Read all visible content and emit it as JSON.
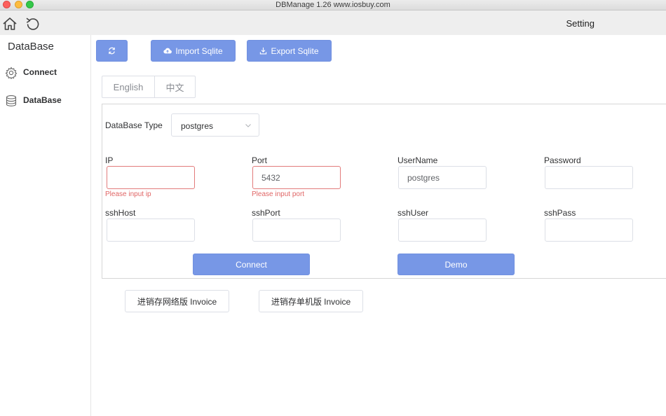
{
  "window": {
    "title": "DBManage 1.26 www.iosbuy.com"
  },
  "header": {
    "title": "Setting"
  },
  "sidebar": {
    "title": "DataBase",
    "items": [
      {
        "label": "Connect",
        "icon": "gear-icon"
      },
      {
        "label": "DataBase",
        "icon": "database-icon"
      }
    ]
  },
  "toolbar": {
    "refresh_icon": "refresh-icon",
    "import_label": "Import Sqlite",
    "export_label": "Export Sqlite"
  },
  "language": {
    "english": "English",
    "chinese": "中文"
  },
  "form": {
    "db_type_label": "DataBase Type",
    "db_type_value": "postgres",
    "ip": {
      "label": "IP",
      "value": "",
      "error": "Please input ip"
    },
    "port": {
      "label": "Port",
      "value": "5432",
      "error": "Please input port"
    },
    "username": {
      "label": "UserName",
      "value": "postgres"
    },
    "password": {
      "label": "Password",
      "value": ""
    },
    "ssh_host": {
      "label": "sshHost",
      "value": ""
    },
    "ssh_port": {
      "label": "sshPort",
      "value": ""
    },
    "ssh_user": {
      "label": "sshUser",
      "value": ""
    },
    "ssh_pass": {
      "label": "sshPass",
      "value": ""
    },
    "connect_label": "Connect",
    "demo_label": "Demo"
  },
  "invoice": {
    "network_label": "进销存网络版 Invoice",
    "single_label": "进销存单机版 Invoice"
  },
  "colors": {
    "primary": "#7797e6",
    "error": "#e06666",
    "border": "#dcdfe6"
  }
}
